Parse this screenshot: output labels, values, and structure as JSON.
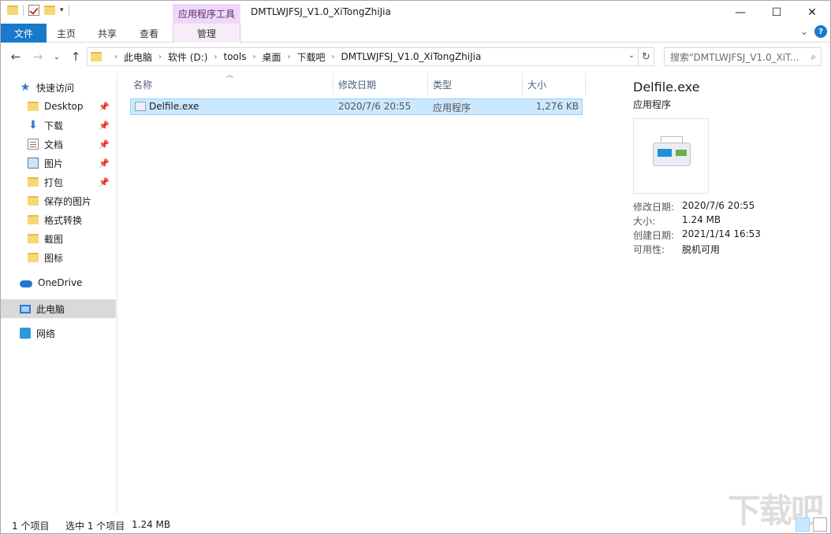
{
  "window": {
    "title": "DMTLWJFSJ_V1.0_XiTongZhiJia",
    "context_tab_group": "应用程序工具",
    "controls": {
      "minimize": "—",
      "maximize": "☐",
      "close": "✕"
    }
  },
  "ribbon": {
    "tabs": [
      "文件",
      "主页",
      "共享",
      "查看",
      "管理"
    ],
    "expand": "⌄",
    "help": "?"
  },
  "nav_buttons": {
    "back": "←",
    "forward": "→",
    "recent": "⌄",
    "up": "↑"
  },
  "address": {
    "crumbs": [
      "此电脑",
      "软件 (D:)",
      "tools",
      "桌面",
      "下载吧",
      "DMTLWJFSJ_V1.0_XiTongZhiJia"
    ],
    "dropdown": "⌄",
    "refresh": "↻"
  },
  "search": {
    "placeholder": "搜索\"DMTLWJFSJ_V1.0_XiT...",
    "icon": "search-icon"
  },
  "nav_pane": {
    "quick_access": "快速访问",
    "items": [
      {
        "label": "Desktop",
        "pinned": true
      },
      {
        "label": "下载",
        "pinned": true
      },
      {
        "label": "文档",
        "pinned": true
      },
      {
        "label": "图片",
        "pinned": true
      },
      {
        "label": "打包",
        "pinned": true
      },
      {
        "label": "保存的图片",
        "pinned": false
      },
      {
        "label": "格式转换",
        "pinned": false
      },
      {
        "label": "截图",
        "pinned": false
      },
      {
        "label": "图标",
        "pinned": false
      }
    ],
    "onedrive": "OneDrive",
    "this_pc": "此电脑",
    "network": "网络"
  },
  "columns": {
    "name": "名称",
    "modified": "修改日期",
    "type": "类型",
    "size": "大小"
  },
  "files": [
    {
      "name": "Delfile.exe",
      "modified": "2020/7/6 20:55",
      "type": "应用程序",
      "size": "1,276 KB",
      "selected": true
    }
  ],
  "preview": {
    "name": "Delfile.exe",
    "type": "应用程序",
    "props": [
      {
        "label": "修改日期:",
        "value": "2020/7/6 20:55"
      },
      {
        "label": "大小:",
        "value": "1.24 MB"
      },
      {
        "label": "创建日期:",
        "value": "2021/1/14 16:53"
      },
      {
        "label": "可用性:",
        "value": "脱机可用"
      }
    ]
  },
  "status": {
    "count": "1 个项目",
    "selected": "选中 1 个项目",
    "selected_size": "1.24 MB"
  },
  "watermark": "下载吧"
}
